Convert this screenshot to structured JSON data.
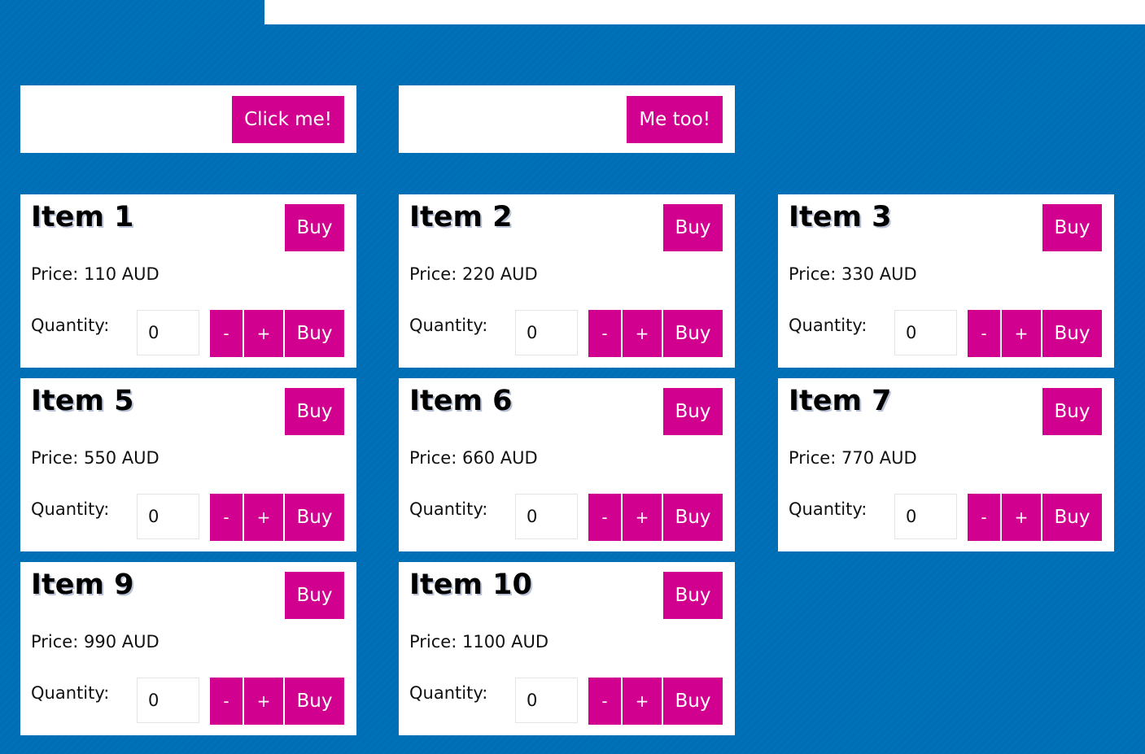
{
  "actions": {
    "click_me_label": "Click me!",
    "me_too_label": "Me too!"
  },
  "items": [
    {
      "title": "Item 1",
      "buy_label": "Buy",
      "price": "Price: 110 AUD",
      "quantity_label": "Quantity:",
      "quantity": "0",
      "minus_label": "-",
      "plus_label": "+",
      "buy_label_2": "Buy"
    },
    {
      "title": "Item 2",
      "buy_label": "Buy",
      "price": "Price: 220 AUD",
      "quantity_label": "Quantity:",
      "quantity": "0",
      "minus_label": "-",
      "plus_label": "+",
      "buy_label_2": "Buy"
    },
    {
      "title": "Item 3",
      "buy_label": "Buy",
      "price": "Price: 330 AUD",
      "quantity_label": "Quantity:",
      "quantity": "0",
      "minus_label": "-",
      "plus_label": "+",
      "buy_label_2": "Buy"
    },
    {
      "title": "Item 5",
      "buy_label": "Buy",
      "price": "Price: 550 AUD",
      "quantity_label": "Quantity:",
      "quantity": "0",
      "minus_label": "-",
      "plus_label": "+",
      "buy_label_2": "Buy"
    },
    {
      "title": "Item 6",
      "buy_label": "Buy",
      "price": "Price: 660 AUD",
      "quantity_label": "Quantity:",
      "quantity": "0",
      "minus_label": "-",
      "plus_label": "+",
      "buy_label_2": "Buy"
    },
    {
      "title": "Item 7",
      "buy_label": "Buy",
      "price": "Price: 770 AUD",
      "quantity_label": "Quantity:",
      "quantity": "0",
      "minus_label": "-",
      "plus_label": "+",
      "buy_label_2": "Buy"
    },
    {
      "title": "Item 9",
      "buy_label": "Buy",
      "price": "Price: 990 AUD",
      "quantity_label": "Quantity:",
      "quantity": "0",
      "minus_label": "-",
      "plus_label": "+",
      "buy_label_2": "Buy"
    },
    {
      "title": "Item 10",
      "buy_label": "Buy",
      "price": "Price: 1100 AUD",
      "quantity_label": "Quantity:",
      "quantity": "0",
      "minus_label": "-",
      "plus_label": "+",
      "buy_label_2": "Buy"
    }
  ],
  "colors": {
    "background": "#0071b8",
    "button": "#d1008f",
    "card": "#ffffff"
  }
}
